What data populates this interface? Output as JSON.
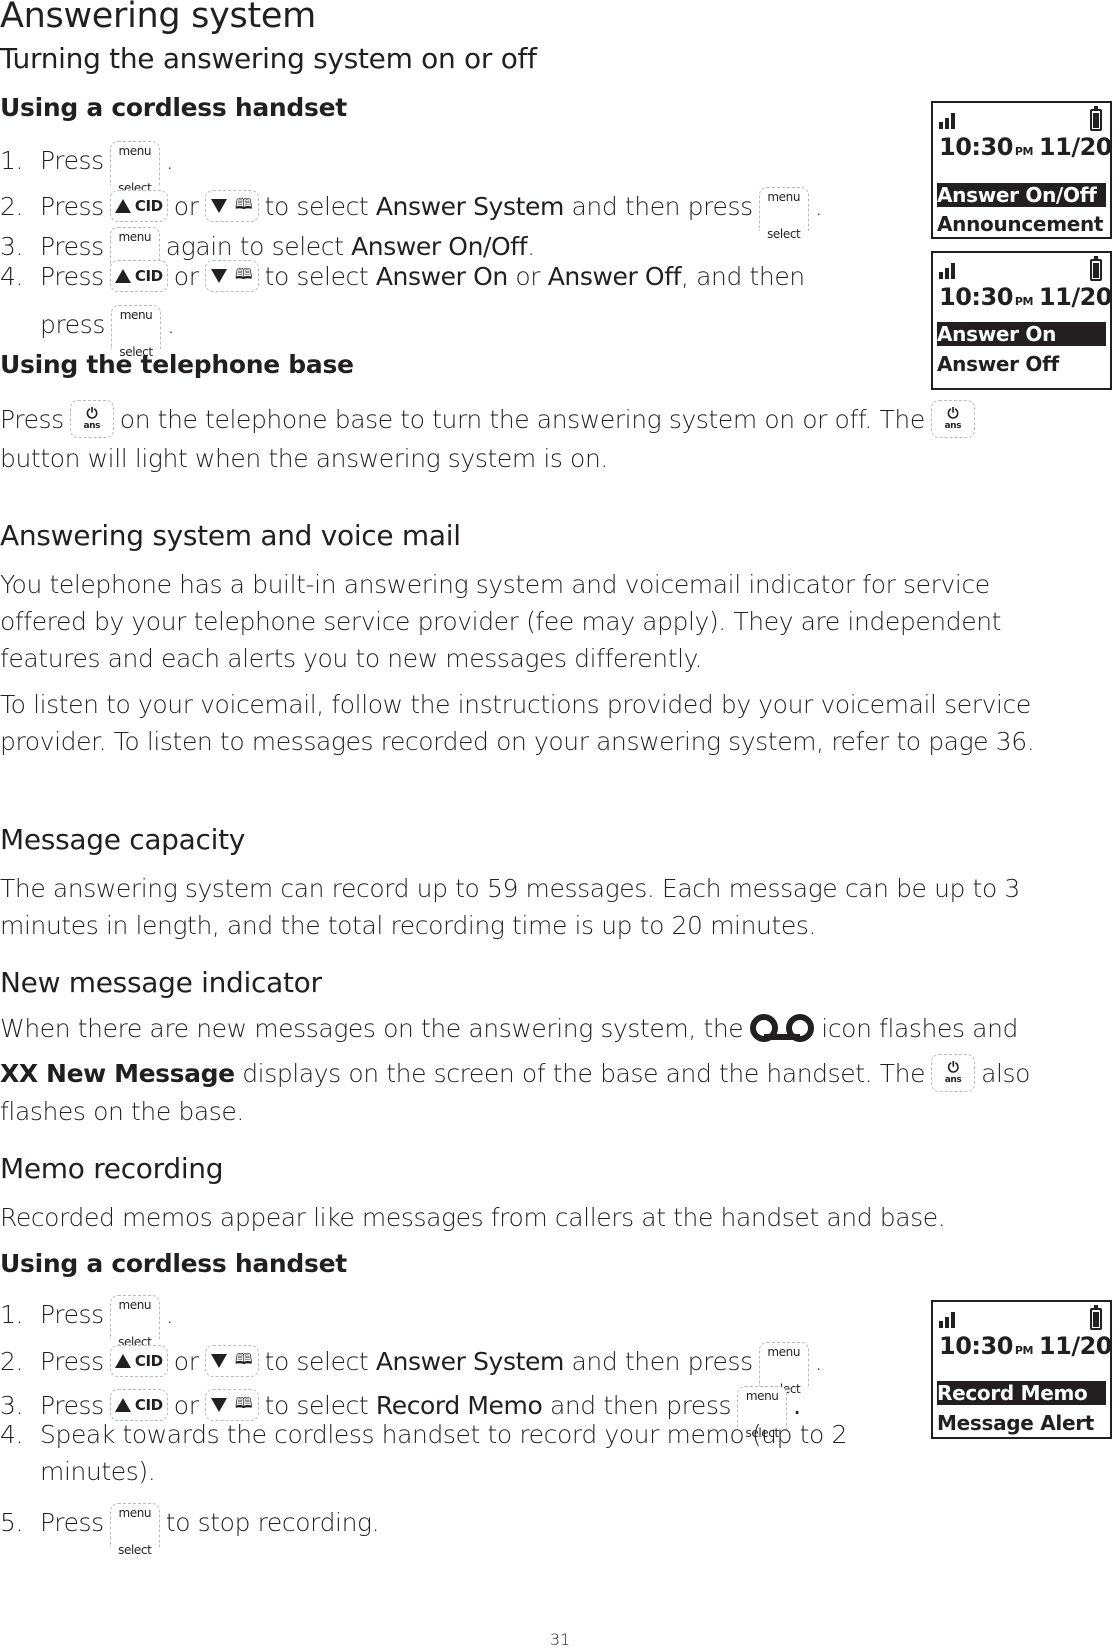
{
  "page": {
    "title": "Answering system",
    "page_number": "31"
  },
  "section_onoff": {
    "heading": "Turning the answering system on or off",
    "handset_heading": "Using a cordless handset",
    "steps": [
      {
        "num": "1.",
        "pre": "Press",
        "post": "."
      },
      {
        "num": "2.",
        "pre": "Press",
        "or": "or",
        "mid": "to select",
        "bold": "Answer System",
        "post": "and then press",
        "end": "."
      },
      {
        "num": "3.",
        "pre": "Press",
        "mid": "again to select",
        "bold": "Answer On/Off",
        "end": "."
      },
      {
        "num": "4.",
        "pre": "Press",
        "or": "or",
        "mid": "to select",
        "bold1": "Answer On",
        "or2": "or",
        "bold2": "Answer Off",
        "post": ", and then",
        "cont": "press",
        "end": "."
      }
    ],
    "base_heading": "Using the telephone base",
    "base_text_1": "Press",
    "base_text_2": "on the telephone base to turn the answering system on or off. The",
    "base_text_3": "button will light when the answering system is on."
  },
  "keys": {
    "menu_top": "menu",
    "menu_bottom": "select",
    "cid_label": "CID",
    "ans_label": "ans",
    "power_glyph": "⏻",
    "book_glyph": "🕮"
  },
  "section_voicemail": {
    "heading": "Answering system and voice mail",
    "para1": "You telephone has a built-in answering system and voicemail indicator for service offered by your telephone service provider (fee may apply). They are independent features and each alerts you to new messages differently.",
    "para2": "To listen to your voicemail, follow the instructions provided by your voicemail service provider. To listen to messages recorded on your answering system, refer to page 36."
  },
  "section_capacity": {
    "heading": "Message capacity",
    "para": "The answering system can record up to 59 messages. Each message can be up to 3 minutes in length, and the total recording time is up to 20 minutes."
  },
  "section_indicator": {
    "heading": "New message indicator",
    "text1": "When there are new messages on the answering system, the",
    "text2": "icon flashes and",
    "bold": "XX New Message",
    "text3": "displays on the screen of the base and the handset. The",
    "text4": "also",
    "text5": "flashes on the base."
  },
  "section_memo": {
    "heading": "Memo recording",
    "para": "Recorded memos appear like messages from callers at the handset and base.",
    "handset_heading": "Using a cordless handset",
    "steps": [
      {
        "num": "1.",
        "pre": "Press",
        "post": "."
      },
      {
        "num": "2.",
        "pre": "Press",
        "or": "or",
        "mid": "to select",
        "bold": "Answer System",
        "post": "and then press",
        "end": "."
      },
      {
        "num": "3.",
        "pre": "Press",
        "or": "or",
        "mid": "to select",
        "bold": "Record Memo",
        "post": "and then press",
        "end": "."
      },
      {
        "num": "4.",
        "text": "Speak towards the cordless handset to record your memo (up to 2",
        "cont": "minutes)."
      },
      {
        "num": "5.",
        "pre": "Press",
        "post": "to stop recording."
      }
    ]
  },
  "screens": [
    {
      "time": "10:30",
      "ampm": "PM",
      "date": "11/20",
      "rows": [
        "Answer On/Off",
        "Announcement"
      ],
      "selected": 0
    },
    {
      "time": "10:30",
      "ampm": "PM",
      "date": "11/20",
      "rows": [
        "Answer On",
        "Answer Off"
      ],
      "selected": 0
    },
    {
      "time": "10:30",
      "ampm": "PM",
      "date": "11/20",
      "rows": [
        "Record Memo",
        "Message Alert"
      ],
      "selected": 0
    }
  ]
}
